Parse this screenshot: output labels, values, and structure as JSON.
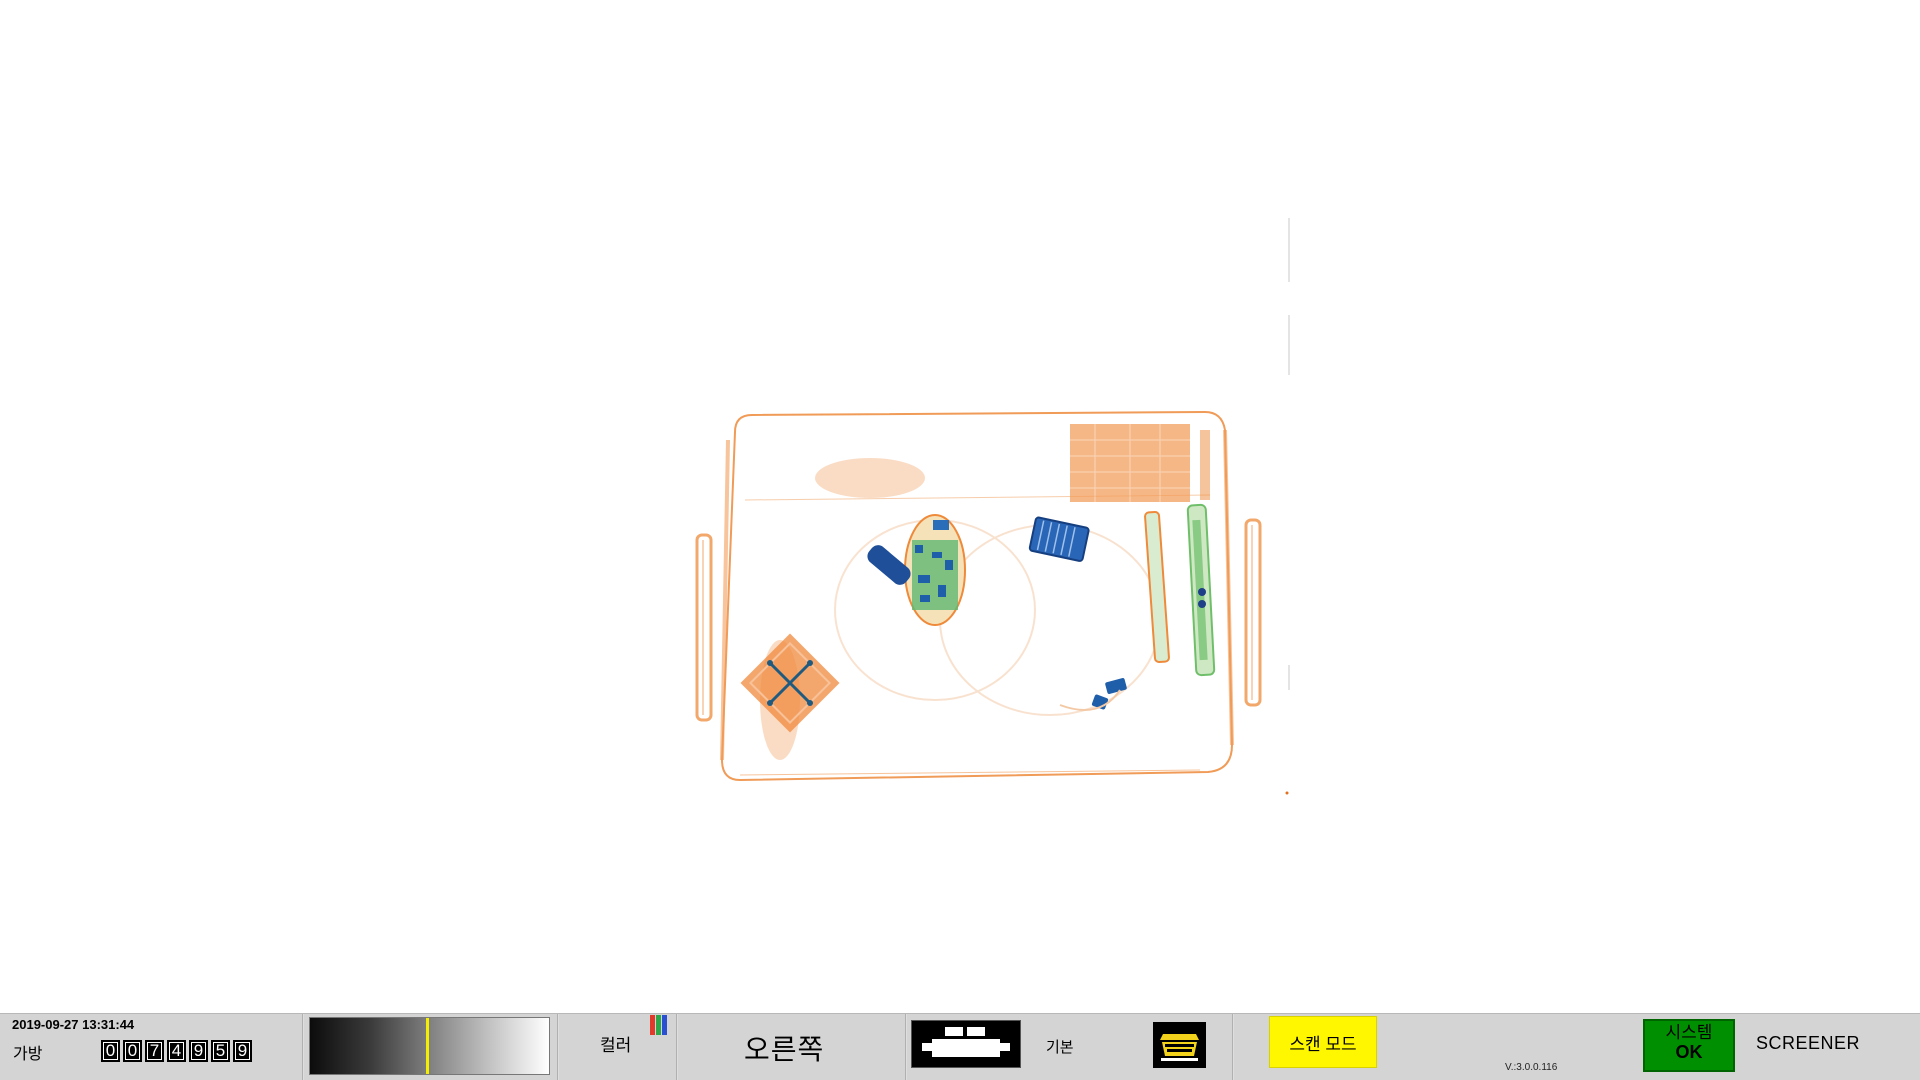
{
  "viewer": {
    "image": "x-ray-scan-image",
    "palette": {
      "organic": "#ee7a22",
      "metal": "#1f5ea8",
      "mixed": "#2aa84a"
    }
  },
  "statusbar": {
    "datetime": "2019-09-27 13:31:44",
    "bag_label": "가방",
    "bag_counter_digits": [
      "0",
      "0",
      "7",
      "4",
      "9",
      "5",
      "9"
    ],
    "gray_level_fraction": 0.49,
    "color_label": "컬러",
    "color_icon": "rgb-bars-icon",
    "direction_label": "오른쪽",
    "conveyor_icon": "conveyor-belt-icon",
    "basic_label": "기본",
    "bin_icon": "tray-bin-icon",
    "scan_mode_label": "스캔 모드",
    "version": "V.:3.0.0.116",
    "system_status_line1": "시스템",
    "system_status_line2": "OK",
    "user_role": "SCREENER"
  }
}
